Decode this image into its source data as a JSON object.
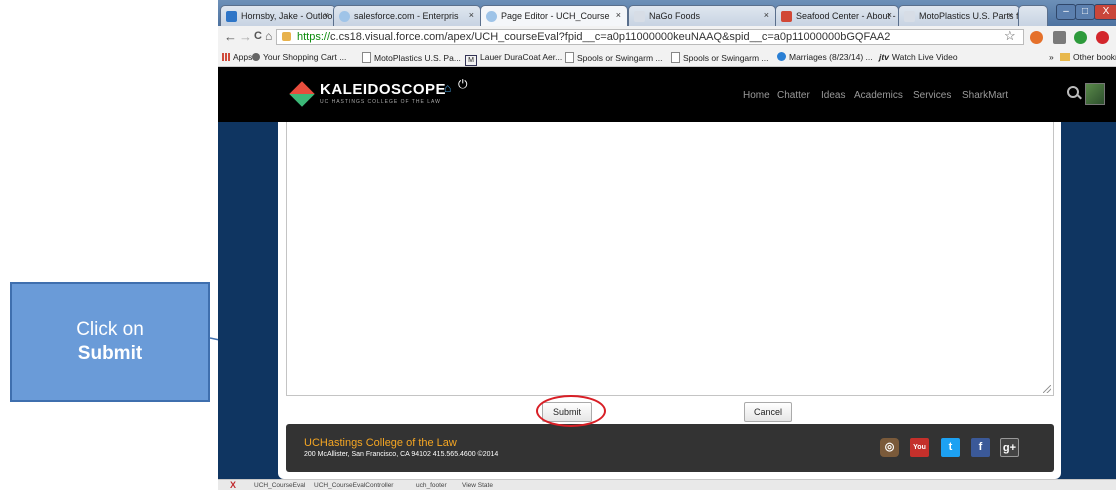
{
  "browser": {
    "tabs": [
      {
        "label": "Hornsby, Jake - Outlook V",
        "favicon": "outlook-icon",
        "color": "#2e75c7",
        "active": false
      },
      {
        "label": "salesforce.com - Enterpris",
        "favicon": "salesforce-cloud-icon",
        "color": "#9fc4e8",
        "active": false
      },
      {
        "label": "Page Editor - UCH_Course",
        "favicon": "page-cloud-icon",
        "color": "#9fc4e8",
        "active": true
      },
      {
        "label": "NaGo Foods",
        "favicon": "page-icon",
        "color": "#d7dde6",
        "active": false
      },
      {
        "label": "Seafood Center - About -",
        "favicon": "google-plus-icon",
        "color": "#d14836",
        "active": false
      },
      {
        "label": "MotoPlastics U.S. Parts fo",
        "favicon": "page-icon",
        "color": "#d7dde6",
        "active": false
      }
    ],
    "tab_close": "×",
    "window_controls": {
      "minimize": "–",
      "maximize": "□",
      "close": "X"
    },
    "nav": {
      "back": "←",
      "forward": "→",
      "reload": "C",
      "home": "⌂"
    },
    "url_https": "https://",
    "url_rest": "c.cs18.visual.force.com/apex/UCH_courseEval?fpid__c=a0p11000000keuNAAQ&spid__c=a0p11000000bGQFAA2",
    "star": "☆",
    "bookmarks": [
      {
        "label": "Apps",
        "icon": "apps-grid-icon"
      },
      {
        "label": "Your Shopping Cart ...",
        "icon": "cart-icon"
      },
      {
        "label": "MotoPlastics U.S. Pa...",
        "icon": "page-icon"
      },
      {
        "label": "Lauer DuraCoat Aer...",
        "icon": "m-logo-icon"
      },
      {
        "label": "Spools or Swingarm ...",
        "icon": "page-icon"
      },
      {
        "label": "Spools or Swingarm ...",
        "icon": "page-icon"
      },
      {
        "label": "Marriages (8/23/14) ...",
        "icon": "marriages-icon"
      },
      {
        "label": "Watch Live Video",
        "icon": "jtv-icon"
      }
    ],
    "bookmarks_more": "»",
    "other_bookmarks": "Other bookma",
    "status_items": [
      "UCH_CourseEval",
      "UCH_CourseEvalController",
      "uch_footer",
      "View State"
    ]
  },
  "site": {
    "logo_text": "KALEIDOSCOPE",
    "logo_sub": "UC HASTINGS COLLEGE OF THE LAW",
    "logo_home_glyph": "⌂",
    "logo_power_glyph": "⏻",
    "nav": [
      "Home",
      "Chatter",
      "Ideas",
      "Academics",
      "Services",
      "SharkMart"
    ]
  },
  "form": {
    "submit_label": "Submit",
    "cancel_label": "Cancel"
  },
  "footer": {
    "title": "UCHastings College of the Law",
    "address": "200 McAllister, San Francisco, CA 94102 415.565.4600 ©2014",
    "social": [
      {
        "name": "instagram-icon",
        "glyph": "◎",
        "color": "#7a5a3a"
      },
      {
        "name": "youtube-icon",
        "glyph": "You",
        "color": "#c4302b"
      },
      {
        "name": "twitter-icon",
        "glyph": "t",
        "color": "#1da1f2"
      },
      {
        "name": "facebook-icon",
        "glyph": "f",
        "color": "#3b5998"
      },
      {
        "name": "google-plus-icon",
        "glyph": "g+",
        "color": "#444"
      }
    ]
  },
  "annotation": {
    "line1": "Click on",
    "line2": "Submit"
  }
}
